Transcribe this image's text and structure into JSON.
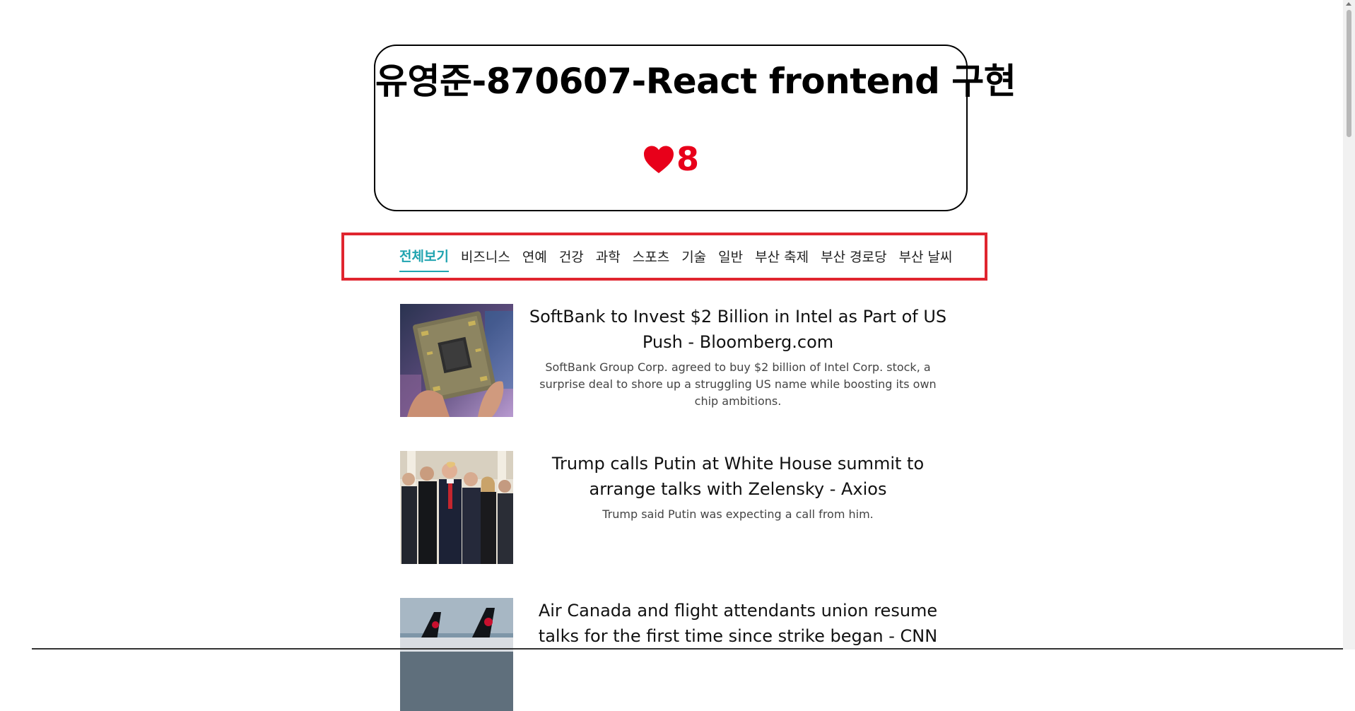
{
  "header": {
    "title": "유영준-870607-React frontend 구현",
    "like_count": "8",
    "heart_color": "#e8001a"
  },
  "nav": {
    "accent_color": "#21a4b0",
    "highlight_color": "#e0252f",
    "items": [
      {
        "label": "전체보기",
        "active": true
      },
      {
        "label": "비즈니스"
      },
      {
        "label": "연예"
      },
      {
        "label": "건강"
      },
      {
        "label": "과학"
      },
      {
        "label": "스포츠"
      },
      {
        "label": "기술"
      },
      {
        "label": "일반"
      },
      {
        "label": "부산 축제"
      },
      {
        "label": "부산 경로당"
      },
      {
        "label": "부산 날씨"
      }
    ]
  },
  "articles": [
    {
      "title": "SoftBank to Invest $2 Billion in Intel as Part of US Push - Bloomberg.com",
      "description": "SoftBank Group Corp. agreed to buy $2 billion of Intel Corp. stock, a surprise deal to shore up a struggling US name while boosting its own chip ambitions.",
      "thumbnail": "chip-in-hand-photo"
    },
    {
      "title": "Trump calls Putin at White House summit to arrange talks with Zelensky - Axios",
      "description": "Trump said Putin was expecting a call from him.",
      "thumbnail": "white-house-summit-photo"
    },
    {
      "title": "Air Canada and flight attendants union resume talks for the first time since strike began - CNN",
      "description": "",
      "thumbnail": "air-canada-planes-photo"
    }
  ]
}
